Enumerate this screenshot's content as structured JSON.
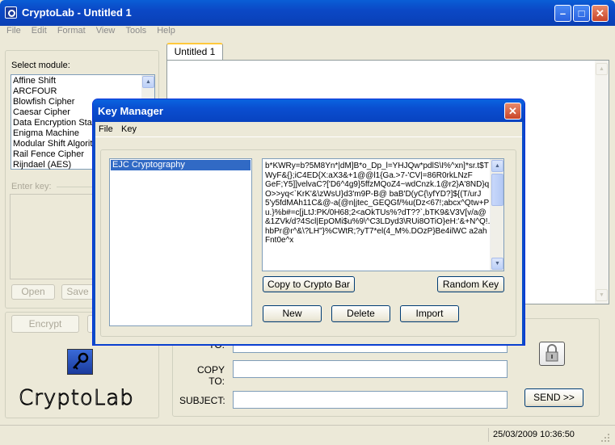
{
  "window": {
    "title": "CryptoLab - Untitled 1"
  },
  "menu": [
    "File",
    "Edit",
    "Format",
    "View",
    "Tools",
    "Help"
  ],
  "sidebar": {
    "select_module_label": "Select module:",
    "modules": [
      "Affine Shift",
      "ARCFOUR",
      "Blowfish Cipher",
      "Caesar Cipher",
      "Data Encryption Sta",
      "Enigma Machine",
      "Modular Shift Algorit",
      "Rail Fence Cipher",
      "Rijndael (AES)"
    ],
    "enter_key_label": "Enter key:",
    "open_label": "Open",
    "save_label": "Save",
    "encrypt_label": "Encrypt",
    "logo_text": "CryptoLab"
  },
  "editor": {
    "tab_label": "Untitled 1"
  },
  "email": {
    "to_label": "TO:",
    "copy_to_label": "COPY TO:",
    "subject_label": "SUBJECT:",
    "send_label": "SEND >>"
  },
  "statusbar": {
    "datetime": "25/03/2009 10:36:50"
  },
  "dialog": {
    "title": "Key Manager",
    "menu": [
      "File",
      "Key"
    ],
    "keys": [
      "EJC Cryptography"
    ],
    "key_text": "b*KWRy=b?5M8Yn*|dM]B*o_Dp_l=YHJQw*pdlS\\I%^xn]*sr.t$TWyF&{};iC4ED{X:aX3&+1@@l1{Ga.>7-'CV|=86R0rkLNzF\nGeF;Y5]]velvaC?['D6^4g9}5ffzMQoZ4~wdCnzk.1@r2}A'8ND}qO>>yq<`KrK'&\\zWsU}d3'm9P-B@ baB'D(yC{\\yfYD?]${(T/urJ5'y5fdMAh11C&@-a{@n|jtec_GEQGf/%u(Dz<67!;abcx^Qtw+Pu.}%b#=c[jLtJ:PK/0H68;2<aOkTUs%?dT??`,bTK9&V3V[v/a@&1ZVk/d?4Scl|EpOMi$u%9\\^C3LDyd3\\RUi8OTiO}eH:'&+N^Q!.hbPr@r^&\\?LH\"}%CWtR;?yT7*el(4_M%.DOzP}Be4ilWC a2ahFnt0e^x",
    "copy_to_crypto_bar_label": "Copy to Crypto Bar",
    "random_key_label": "Random Key",
    "new_label": "New",
    "delete_label": "Delete",
    "import_label": "Import"
  },
  "colors": {
    "title_bar": "#0a4ed0",
    "selection": "#316ac5",
    "window_bg": "#ece9d8"
  }
}
